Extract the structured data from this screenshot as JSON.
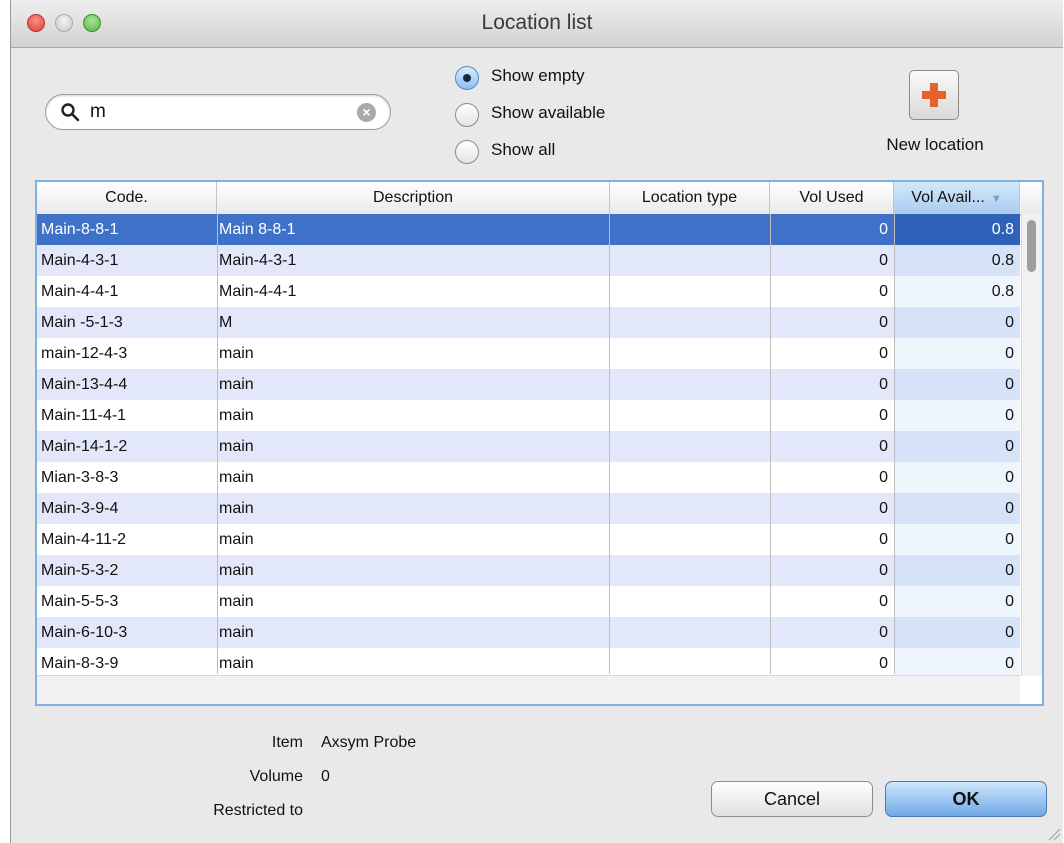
{
  "window": {
    "title": "Location list"
  },
  "search": {
    "value": "m",
    "placeholder": ""
  },
  "filters": {
    "options": [
      {
        "label": "Show empty",
        "selected": true
      },
      {
        "label": "Show available",
        "selected": false
      },
      {
        "label": "Show all",
        "selected": false
      }
    ]
  },
  "new_location": {
    "label": "New location"
  },
  "table": {
    "columns": [
      "Code.",
      "Description",
      "Location type",
      "Vol Used",
      "Vol Avail..."
    ],
    "sorted_column": "Vol Avail...",
    "rows": [
      {
        "code": "Main-8-8-1",
        "description": "Main 8-8-1",
        "type": "",
        "used": "0",
        "avail": "0.8",
        "selected": true
      },
      {
        "code": "Main-4-3-1",
        "description": "Main-4-3-1",
        "type": "",
        "used": "0",
        "avail": "0.8"
      },
      {
        "code": "Main-4-4-1",
        "description": "Main-4-4-1",
        "type": "",
        "used": "0",
        "avail": "0.8"
      },
      {
        "code": "Main -5-1-3",
        "description": "M",
        "type": "",
        "used": "0",
        "avail": "0"
      },
      {
        "code": "main-12-4-3",
        "description": "main",
        "type": "",
        "used": "0",
        "avail": "0"
      },
      {
        "code": "Main-13-4-4",
        "description": "main",
        "type": "",
        "used": "0",
        "avail": "0"
      },
      {
        "code": "Main-11-4-1",
        "description": "main",
        "type": "",
        "used": "0",
        "avail": "0"
      },
      {
        "code": "Main-14-1-2",
        "description": "main",
        "type": "",
        "used": "0",
        "avail": "0"
      },
      {
        "code": "Mian-3-8-3",
        "description": "main",
        "type": "",
        "used": "0",
        "avail": "0"
      },
      {
        "code": "Main-3-9-4",
        "description": "main",
        "type": "",
        "used": "0",
        "avail": "0"
      },
      {
        "code": "Main-4-11-2",
        "description": "main",
        "type": "",
        "used": "0",
        "avail": "0"
      },
      {
        "code": "Main-5-3-2",
        "description": "main",
        "type": "",
        "used": "0",
        "avail": "0"
      },
      {
        "code": "Main-5-5-3",
        "description": "main",
        "type": "",
        "used": "0",
        "avail": "0"
      },
      {
        "code": "Main-6-10-3",
        "description": "main",
        "type": "",
        "used": "0",
        "avail": "0"
      },
      {
        "code": "Main-8-3-9",
        "description": "main",
        "type": "",
        "used": "0",
        "avail": "0"
      }
    ]
  },
  "details": {
    "item_label": "Item",
    "item_value": "Axsym Probe",
    "volume_label": "Volume",
    "volume_value": "0",
    "restricted_label": "Restricted to",
    "restricted_value": ""
  },
  "buttons": {
    "cancel": "Cancel",
    "ok": "OK"
  },
  "colors": {
    "selection": "#3f71c9",
    "alt_row": "#e2e8fa",
    "focus_ring": "#7eb0e0",
    "new_location_plus": "#e8602c"
  }
}
